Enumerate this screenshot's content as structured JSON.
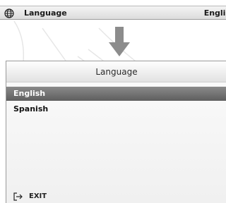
{
  "top_bar": {
    "label": "Language",
    "value": "Englis",
    "icon": "globe-icon"
  },
  "arrow": {
    "icon": "arrow-down-icon"
  },
  "panel": {
    "title": "Language",
    "items": [
      {
        "label": "English",
        "selected": true
      },
      {
        "label": "Spanish",
        "selected": false
      }
    ],
    "exit_label": "EXIT",
    "exit_icon": "exit-icon"
  },
  "colors": {
    "selected_bg": "#6e6e6e",
    "arrow": "#8c8c8c"
  }
}
